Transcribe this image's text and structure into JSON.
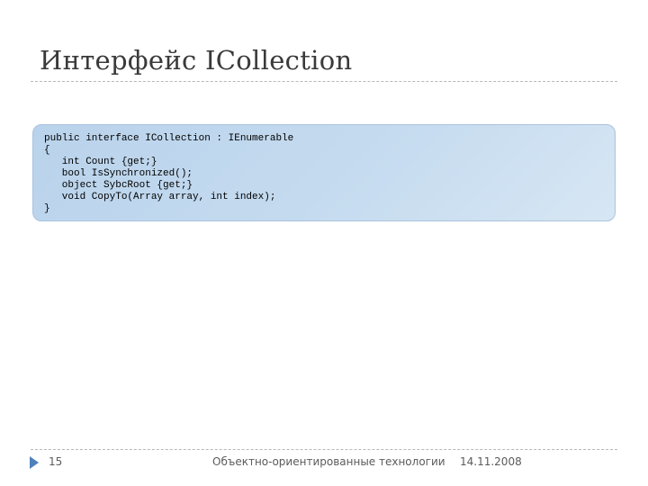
{
  "slide": {
    "title": "Интерфейс ICollection",
    "code_lines": [
      "public interface ICollection : IEnumerable",
      "{",
      "   int Count {get;}",
      "   bool IsSynchronized();",
      "   object SybcRoot {get;}",
      "   void CopyTo(Array array, int index);",
      "}"
    ]
  },
  "footer": {
    "page_number": "15",
    "course": "Объектно-ориентированные технологии",
    "date": "14.11.2008",
    "accent_color": "#4f81bd"
  }
}
